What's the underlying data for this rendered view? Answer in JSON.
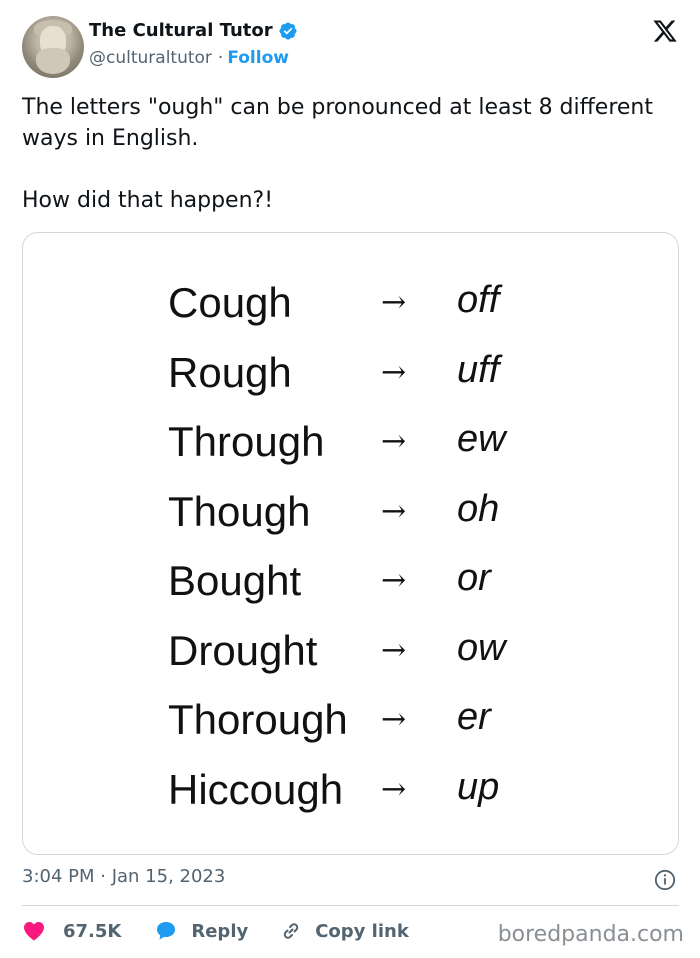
{
  "author": {
    "name": "The Cultural Tutor",
    "handle": "@culturaltutor",
    "separator": "·",
    "follow_label": "Follow",
    "verified_color": "#1d9bf0"
  },
  "tweet": {
    "line1": "The letters \"ough\" can be pronounced at least 8 different ways in English.",
    "line2": "How did that happen?!"
  },
  "media": {
    "arrow": "→",
    "rows": [
      {
        "word": "Cough",
        "sound": "off"
      },
      {
        "word": "Rough",
        "sound": "uff"
      },
      {
        "word": "Through",
        "sound": "ew"
      },
      {
        "word": "Though",
        "sound": "oh"
      },
      {
        "word": "Bought",
        "sound": "or"
      },
      {
        "word": "Drought",
        "sound": "ow"
      },
      {
        "word": "Thorough",
        "sound": "er"
      },
      {
        "word": "Hiccough",
        "sound": "up"
      }
    ]
  },
  "meta": {
    "timestamp": "3:04 PM · Jan 15, 2023"
  },
  "actions": {
    "like_count": "67.5K",
    "reply_label": "Reply",
    "copy_label": "Copy link",
    "like_color": "#f91880",
    "reply_color": "#1d9bf0"
  },
  "watermark": "boredpanda.com"
}
